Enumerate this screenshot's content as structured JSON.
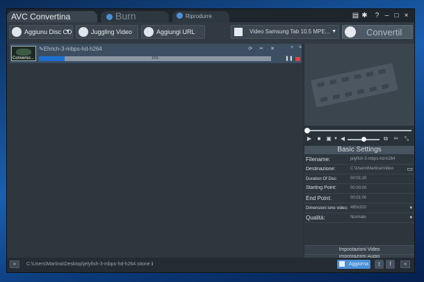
{
  "tabs": {
    "convert": "AVC Convertina",
    "burn": "Burn",
    "play": "Riprodurre"
  },
  "window_controls": {
    "minimize": "–",
    "maximize": "□",
    "close": "×",
    "help": "?"
  },
  "toolbar": {
    "add_disc": "Aggiunu Disc CD",
    "add_video": "Juggling Video",
    "add_url": "Aggiungi URL",
    "profile": "Video Samsung Tab 10.5 MPE...",
    "convert": "Convertil"
  },
  "file_item": {
    "name": "Ehrich-3-mbps-hd-h264",
    "thumb_caption": "Converso...",
    "progress_text": "11%",
    "progress": 0.11
  },
  "settings": {
    "title": "Basic Settings",
    "rows": [
      {
        "label": "Filename:",
        "value": "jelyfish-3-mbps-hd-h264"
      },
      {
        "label": "Destinazione:",
        "value": "C:\\Users\\Martina\\Video"
      },
      {
        "label": "Duration Of Disc",
        "value": "00:01:20"
      },
      {
        "label": "Starting Point:",
        "value": "00:00:00"
      },
      {
        "label": "End Point:",
        "value": "00:01:00"
      },
      {
        "label": "Dimensioni ione video:",
        "value": "480x320"
      },
      {
        "label": "Qualità:",
        "value": "Normale"
      }
    ],
    "video_btn": "Impostazioni Video",
    "audio_btn": "Impostazioni Audio"
  },
  "status": {
    "path": "C:\\Users\\Martina\\Desktop\\jelyfish-3-mbps-hd-h264.stione ℹ",
    "update": "Aggiorna",
    "prev": "«",
    "next": "»"
  },
  "colors": {
    "accent": "#1f6fd0",
    "progress_bg": "#8a97a2",
    "window": "#2a323a"
  },
  "icons": [
    "add-disc-icon",
    "add-video-icon",
    "add-url-icon",
    "profile-icon",
    "convert-icon",
    "pin-icon",
    "settings-icon",
    "help-icon",
    "play-icon",
    "stop-icon",
    "snapshot-icon",
    "volume-icon",
    "copy-icon",
    "scissors-icon",
    "fullscreen-icon",
    "twitter-icon",
    "facebook-icon"
  ]
}
